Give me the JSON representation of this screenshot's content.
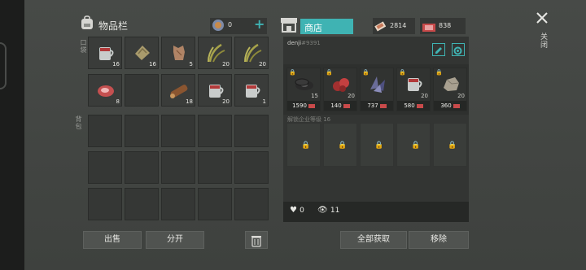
{
  "inventory": {
    "title": "物品栏",
    "quick_label": "口袋",
    "backpack_label": "背包",
    "currency_amount": "0",
    "add_symbol": "+",
    "quick_slots": [
      {
        "item": "cup-of-water",
        "count": "16"
      },
      {
        "item": "rope-bundle",
        "count": "16"
      },
      {
        "item": "animal-hide",
        "count": "5"
      },
      {
        "item": "plant-fiber",
        "count": "20"
      },
      {
        "item": "plant-fiber",
        "count": "20"
      },
      {
        "item": "raw-meat",
        "count": "8"
      },
      {
        "item": "empty",
        "count": ""
      },
      {
        "item": "wood-log",
        "count": "18"
      },
      {
        "item": "cup-of-water",
        "count": "20"
      },
      {
        "item": "cup-of-water",
        "count": "1"
      }
    ]
  },
  "shop": {
    "title": "商店",
    "money_a": "2814",
    "money_b": "838",
    "owner": "denji",
    "owner_id": "#9391",
    "items": [
      {
        "item": "tire-stack",
        "qty": "15",
        "price": "1590"
      },
      {
        "item": "red-berries",
        "qty": "20",
        "price": "140"
      },
      {
        "item": "crystal-shards",
        "qty": "",
        "price": "737"
      },
      {
        "item": "cup-of-water",
        "qty": "20",
        "price": "580"
      },
      {
        "item": "stone",
        "qty": "20",
        "price": "360"
      }
    ],
    "unlock_text": "解锁企业等级 16",
    "likes": "0",
    "views": "11"
  },
  "close_label": "关闭",
  "buttons": {
    "sell": "出售",
    "split": "分开",
    "take_all": "全部获取",
    "remove": "移除"
  },
  "colors": {
    "accent_teal": "#3fb3b3",
    "price_red": "#c84a4a"
  }
}
